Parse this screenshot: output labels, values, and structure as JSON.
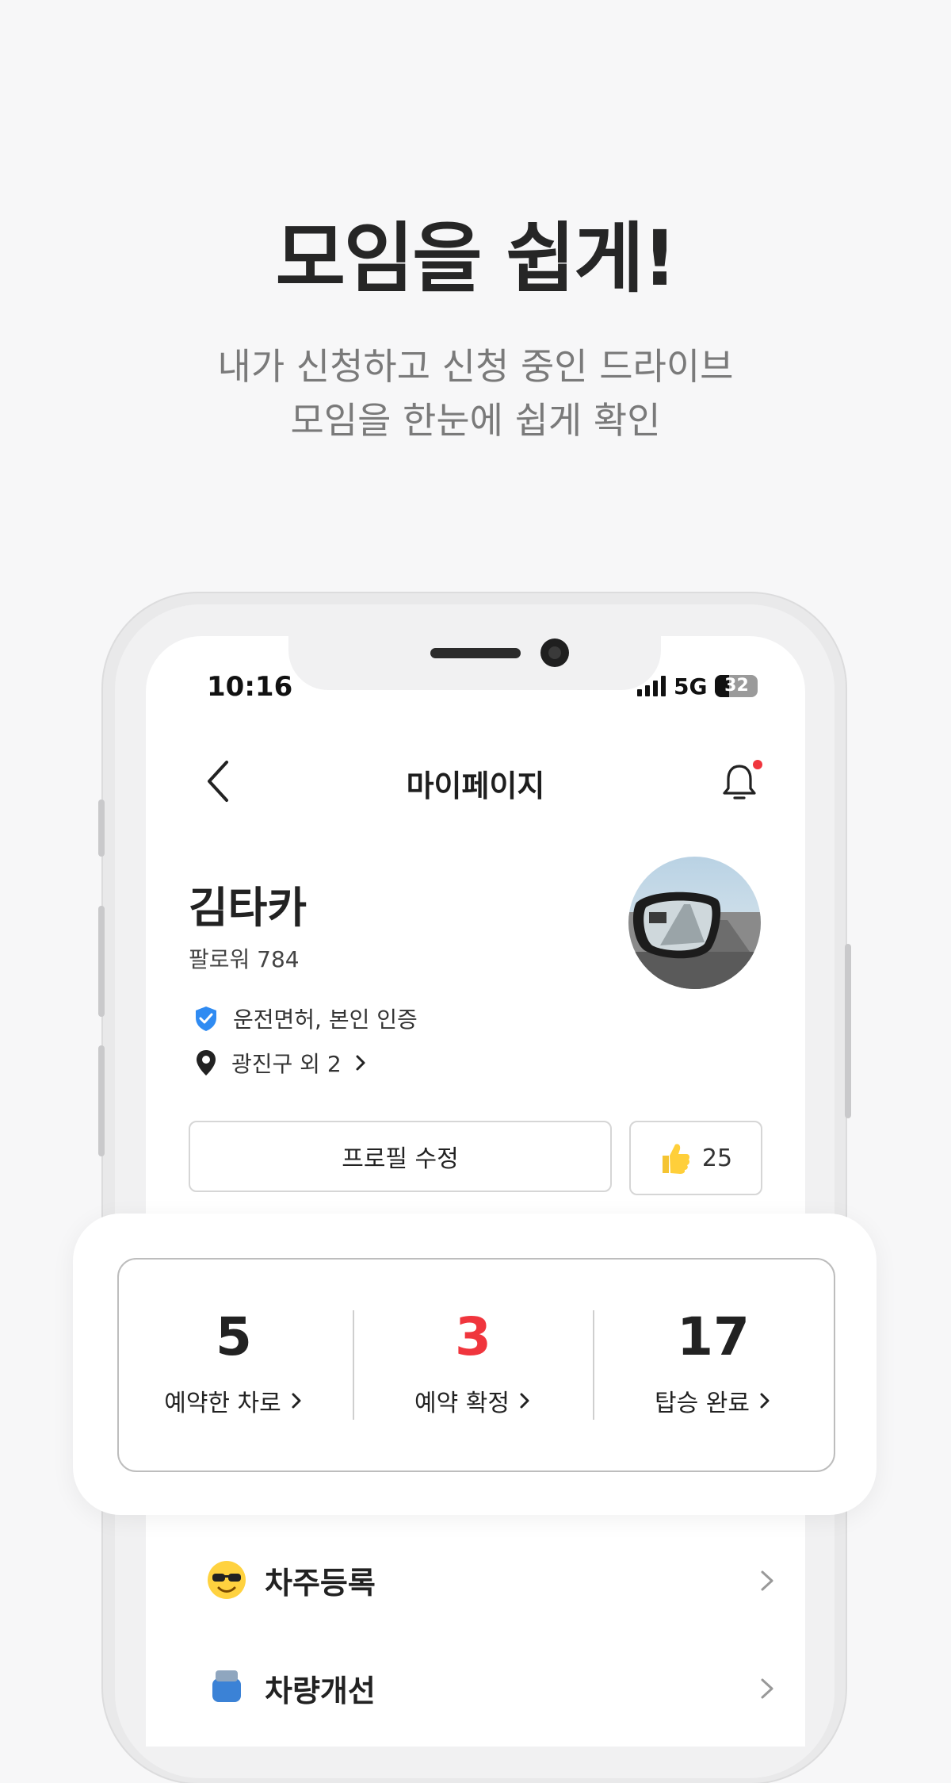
{
  "headline": "모임을 쉽게!",
  "subline": [
    "내가 신청하고 신청 중인 드라이브",
    "모임을 한눈에 쉽게 확인"
  ],
  "status_bar": {
    "time": "10:16",
    "network": "5G",
    "battery": "32"
  },
  "header": {
    "title": "마이페이지",
    "back_icon": "chevron-left-icon",
    "bell_icon": "bell-icon"
  },
  "profile": {
    "name": "김타카",
    "followers": "팔로워 784",
    "verification": "운전면허, 본인 인증",
    "location": "광진구 외 2",
    "edit_button": "프로필 수정",
    "likes": "25"
  },
  "stats": [
    {
      "value": "5",
      "label": "예약한 차로",
      "color": "#222222"
    },
    {
      "value": "3",
      "label": "예약 확정",
      "color": "#f0353d"
    },
    {
      "value": "17",
      "label": "탑승 완료",
      "color": "#222222"
    }
  ],
  "menu": [
    {
      "label": "차주등록",
      "icon": "sunglasses-emoji-icon"
    },
    {
      "label": "차량개선",
      "icon": "car-icon"
    }
  ],
  "colors": {
    "accent_red": "#f0353d",
    "verify_blue": "#2f8bf2",
    "background": "#f7f7f8"
  }
}
